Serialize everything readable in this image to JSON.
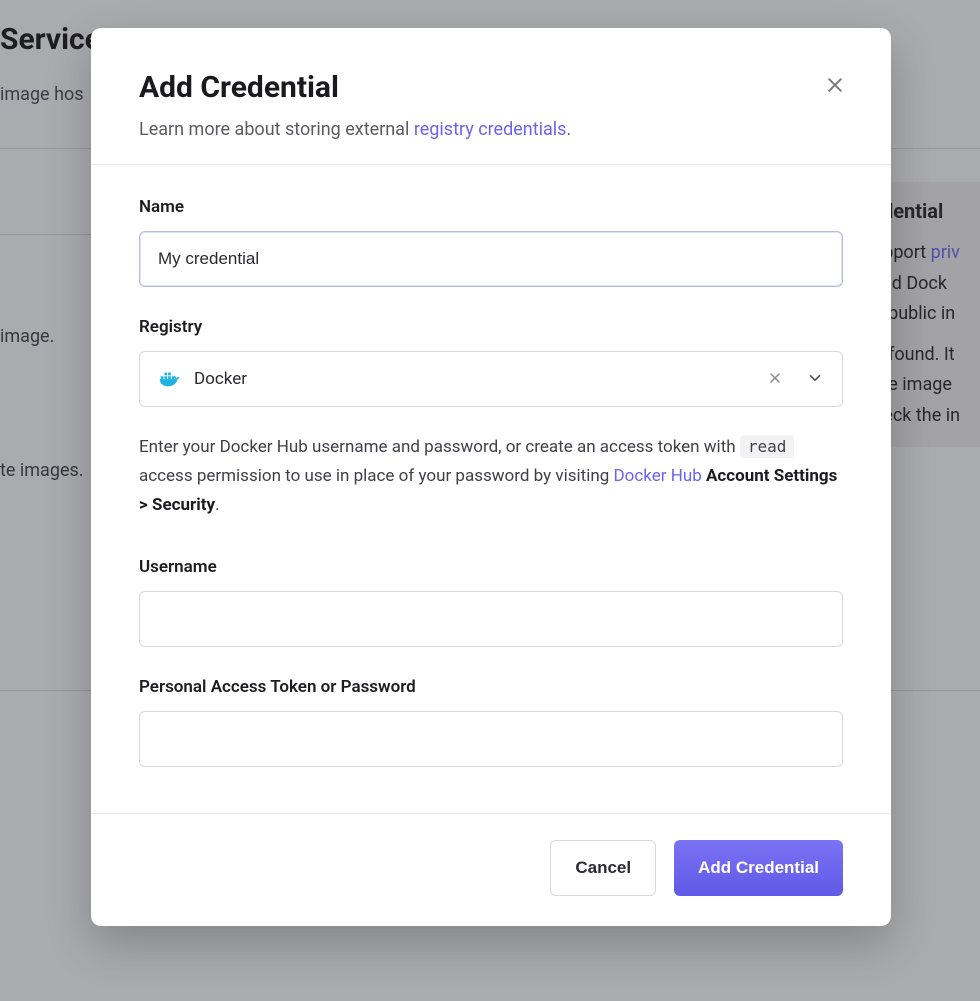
{
  "background": {
    "page_title": "Service",
    "page_subtitle": "image hos",
    "line_image": "image.",
    "line_te_images": "te images.",
    "right_panel": {
      "heading": "redential",
      "l1_a": "support ",
      "l1_link": "priv",
      "l2": ", and Dock",
      "l3": "ict public in",
      "l4": "ge found. It",
      "l5": "vate image",
      "l6": "check the in"
    }
  },
  "modal": {
    "title": "Add Credential",
    "subtitle_prefix": "Learn more about storing external ",
    "subtitle_link": "registry credentials",
    "subtitle_suffix": ".",
    "close_label": "Close",
    "fields": {
      "name": {
        "label": "Name",
        "value": "My credential"
      },
      "registry": {
        "label": "Registry",
        "value": "Docker",
        "icon": "docker-icon"
      },
      "username": {
        "label": "Username",
        "value": ""
      },
      "token": {
        "label": "Personal Access Token or Password",
        "value": ""
      }
    },
    "help": {
      "t1": "Enter your Docker Hub username and password, or create an access token with ",
      "code": "read",
      "t2": " access permission to use in place of your password by visiting ",
      "link": "Docker Hub",
      "t3": " ",
      "bold": "Account Settings > Security",
      "t4": "."
    },
    "footer": {
      "cancel": "Cancel",
      "submit": "Add Credential"
    }
  }
}
